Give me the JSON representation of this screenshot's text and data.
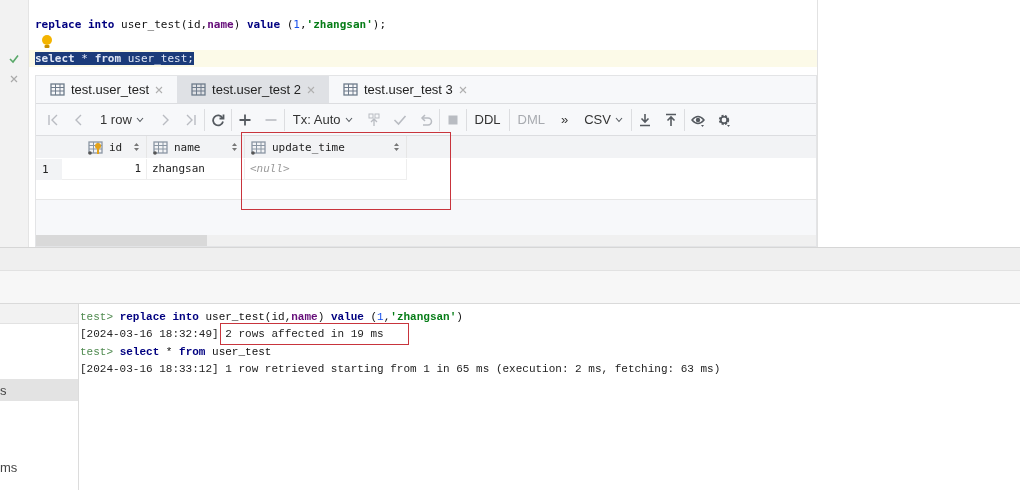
{
  "editor": {
    "lines": [
      {
        "kind": "code",
        "executed": false,
        "selected": false,
        "tokens": [
          {
            "kind": "keyword",
            "text": "replace into"
          },
          {
            "kind": "plain",
            "text": " user_test(id,"
          },
          {
            "kind": "field",
            "text": "name"
          },
          {
            "kind": "plain",
            "text": ") "
          },
          {
            "kind": "keyword",
            "text": "value"
          },
          {
            "kind": "plain",
            "text": " ("
          },
          {
            "kind": "number",
            "text": "1"
          },
          {
            "kind": "plain",
            "text": ","
          },
          {
            "kind": "string",
            "text": "'zhangsan'"
          },
          {
            "kind": "plain",
            "text": ");"
          }
        ]
      },
      {
        "kind": "intention"
      },
      {
        "kind": "code",
        "executed": true,
        "selected": true,
        "tokens": [
          {
            "kind": "keyword",
            "text": "select"
          },
          {
            "kind": "plain",
            "text": " * "
          },
          {
            "kind": "keyword",
            "text": "from"
          },
          {
            "kind": "plain",
            "text": " user_test;"
          }
        ]
      }
    ]
  },
  "results": {
    "tabs": [
      {
        "label": "test.user_test",
        "selected": false
      },
      {
        "label": "test.user_test 2",
        "selected": true
      },
      {
        "label": "test.user_test 3",
        "selected": false
      }
    ],
    "toolbar": [
      [
        {
          "kind": "first",
          "disabled": true
        },
        {
          "kind": "prev",
          "disabled": true
        },
        {
          "kind": "dropdown",
          "label": "1 row",
          "disabled": false
        },
        {
          "kind": "next",
          "disabled": true
        },
        {
          "kind": "last",
          "disabled": true
        }
      ],
      [
        {
          "kind": "refresh",
          "disabled": false
        }
      ],
      [
        {
          "kind": "add",
          "disabled": false
        },
        {
          "kind": "remove",
          "disabled": true
        }
      ],
      [
        {
          "kind": "dropdown",
          "label": "Tx: Auto",
          "disabled": false
        },
        {
          "kind": "commit",
          "disabled": true
        },
        {
          "kind": "submit",
          "disabled": true
        },
        {
          "kind": "revert",
          "disabled": true
        }
      ],
      [
        {
          "kind": "stop",
          "disabled": true
        }
      ],
      [
        {
          "kind": "text",
          "label": "DDL",
          "disabled": false
        }
      ],
      [
        {
          "kind": "text",
          "label": "DML",
          "disabled": true
        },
        {
          "kind": "text",
          "label": "»",
          "disabled": false
        },
        {
          "kind": "dropdown",
          "label": "CSV",
          "disabled": false
        }
      ],
      [
        {
          "kind": "download",
          "disabled": false
        },
        {
          "kind": "upload",
          "disabled": false
        }
      ],
      [
        {
          "kind": "view",
          "disabled": false
        },
        {
          "kind": "settings",
          "disabled": false
        }
      ]
    ],
    "columns": [
      {
        "name": "id",
        "kind": "key",
        "highlighted": false
      },
      {
        "name": "name",
        "kind": "column",
        "highlighted": false
      },
      {
        "name": "update_time",
        "kind": "column",
        "highlighted": true
      }
    ],
    "rows": [
      {
        "number": "1",
        "cells": [
          {
            "text": "1",
            "null": false
          },
          {
            "text": "zhangsan",
            "null": false
          },
          {
            "text": "<null>",
            "null": true
          }
        ]
      }
    ]
  },
  "console": {
    "sidebar": [
      {
        "label": "s",
        "selected": true
      },
      {
        "label": "ms",
        "selected": false
      }
    ],
    "lines": [
      {
        "kind": "command",
        "prompt": "test>",
        "tokens": [
          {
            "kind": "keyword",
            "text": "replace into"
          },
          {
            "kind": "plain",
            "text": " user_test(id,"
          },
          {
            "kind": "field",
            "text": "name"
          },
          {
            "kind": "plain",
            "text": ") "
          },
          {
            "kind": "keyword",
            "text": "value"
          },
          {
            "kind": "plain",
            "text": " ("
          },
          {
            "kind": "number",
            "text": "1"
          },
          {
            "kind": "plain",
            "text": ","
          },
          {
            "kind": "string",
            "text": "'zhangsan'"
          },
          {
            "kind": "plain",
            "text": ")"
          }
        ]
      },
      {
        "kind": "log",
        "time": "[2024-03-16 18:32:49]",
        "message": "2 rows affected in 19 ms",
        "highlighted": true
      },
      {
        "kind": "command",
        "prompt": "test>",
        "tokens": [
          {
            "kind": "keyword",
            "text": "select"
          },
          {
            "kind": "plain",
            "text": " * "
          },
          {
            "kind": "keyword",
            "text": "from"
          },
          {
            "kind": "plain",
            "text": " user_test"
          }
        ]
      },
      {
        "kind": "log",
        "time": "[2024-03-16 18:33:12]",
        "message": "1 row retrieved starting from 1 in 65 ms (execution: 2 ms, fetching: 63 ms)",
        "highlighted": false
      }
    ]
  }
}
